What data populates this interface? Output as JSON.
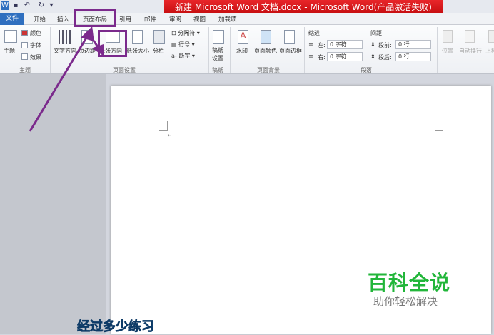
{
  "window": {
    "title": "新建 Microsoft Word 文档.docx - Microsoft Word(产品激活失败)"
  },
  "tabs": [
    "文件",
    "开始",
    "插入",
    "页面布局",
    "引用",
    "邮件",
    "审阅",
    "视图",
    "加载项"
  ],
  "ribbon": {
    "theme": {
      "main": "主题",
      "colors": "颜色",
      "fonts": "字体",
      "effects": "效果",
      "group": "主题"
    },
    "page_setup": {
      "text_direction": "文字方向",
      "margins": "页边距",
      "orientation": "纸张方向",
      "size": "纸张大小",
      "columns": "分栏",
      "breaks": "分隔符",
      "line_numbers": "行号",
      "hyphenation": "断字",
      "group": "页面设置"
    },
    "manuscript": {
      "settings_line1": "稿纸",
      "settings_line2": "设置",
      "group": "稿纸"
    },
    "background": {
      "watermark": "水印",
      "page_color": "页面颜色",
      "page_borders": "页面边框",
      "group": "页面背景"
    },
    "paragraph": {
      "indent": "缩进",
      "left": "左:",
      "right": "右:",
      "left_value": "0 字符",
      "right_value": "0 字符",
      "spacing": "间距",
      "before": "段前:",
      "after": "段后:",
      "before_value": "0 行",
      "after_value": "0 行",
      "group": "段落"
    },
    "arrange": {
      "position": "位置",
      "wrap": "自动换行",
      "forward": "上移"
    }
  },
  "overlay": {
    "watermark_title": "百科全说",
    "watermark_sub": "助你轻松解决",
    "caption": "经过多少练习",
    "accent": "#7b2a8c"
  }
}
